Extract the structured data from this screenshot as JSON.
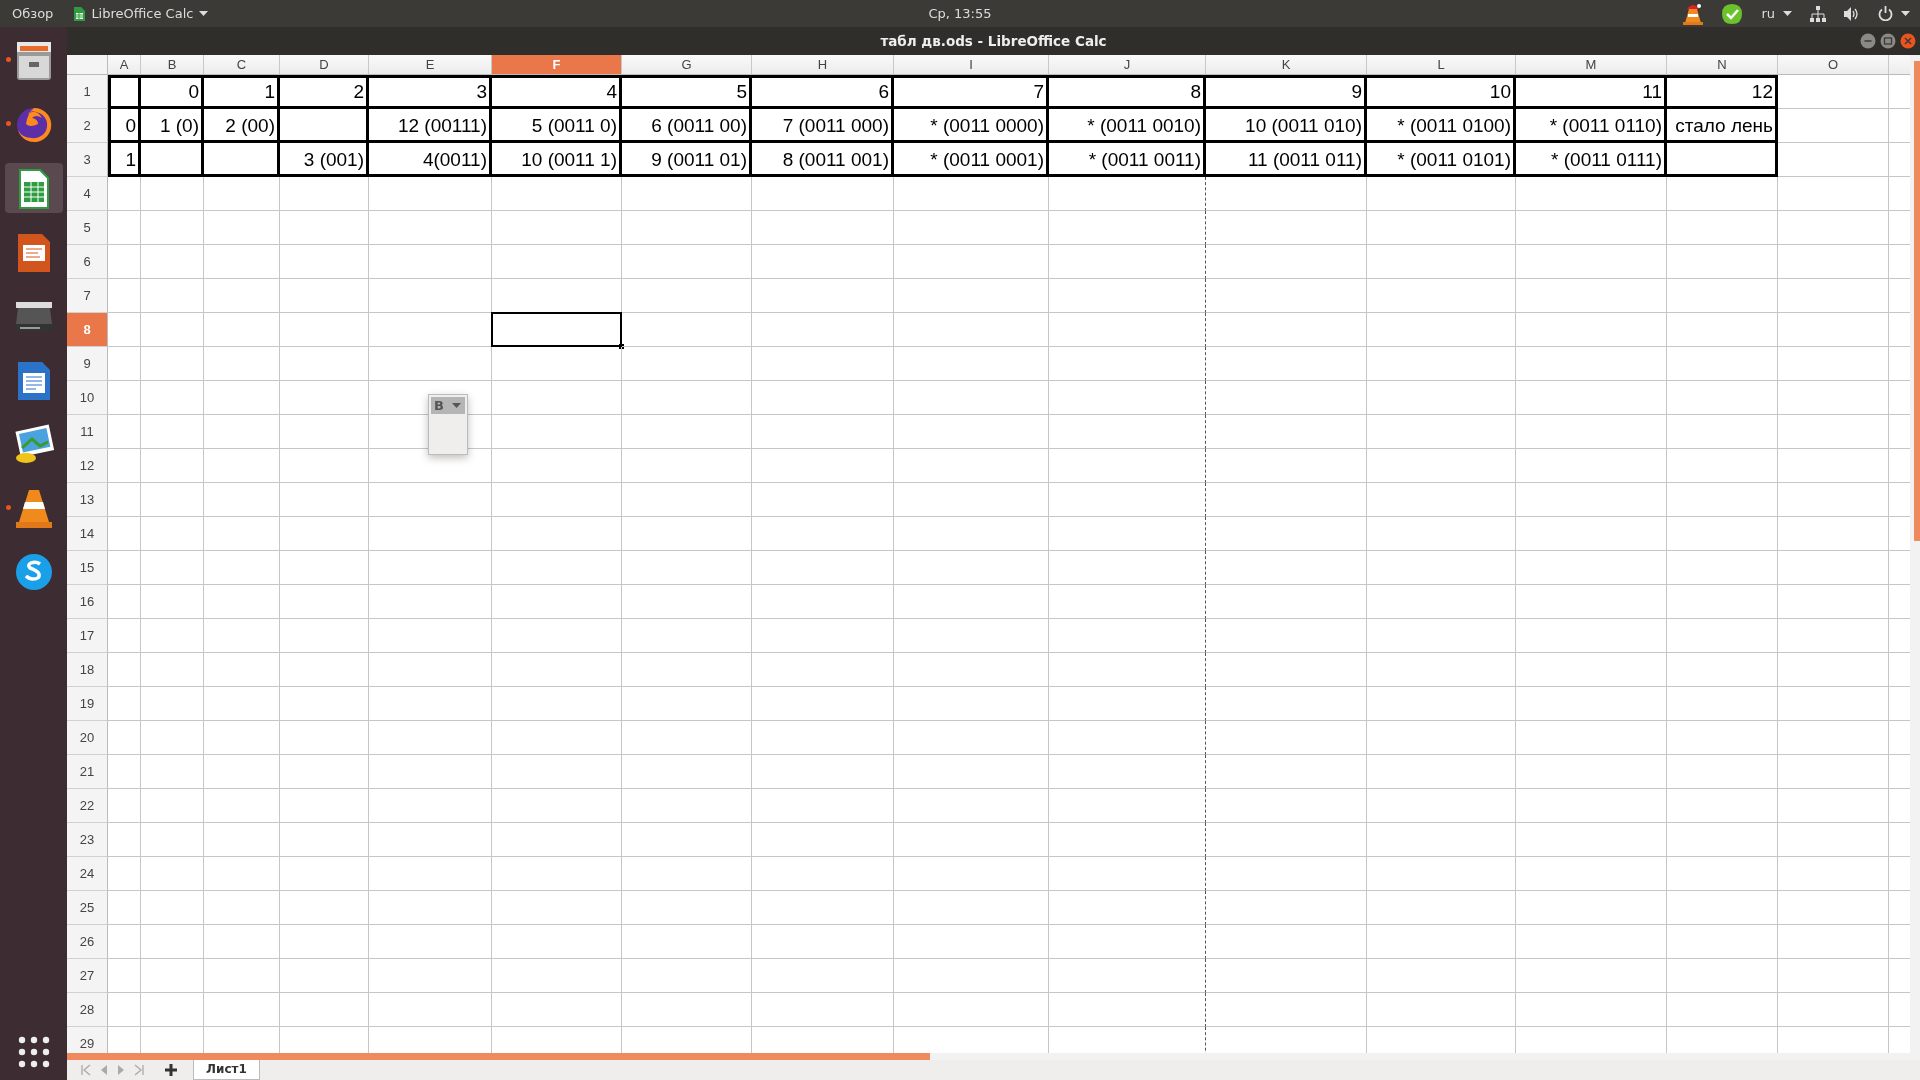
{
  "top_bar": {
    "activities": "Обзор",
    "app_menu": "LibreOffice Calc",
    "clock": "Ср, 13:55",
    "language": "ru"
  },
  "dock": {
    "items": [
      {
        "kind": "files",
        "running": true,
        "selected": false
      },
      {
        "kind": "browser",
        "running": true,
        "selected": false
      },
      {
        "kind": "spreadsheet",
        "running": false,
        "selected": true
      },
      {
        "kind": "presentation",
        "running": false,
        "selected": false
      },
      {
        "kind": "scanner",
        "running": false,
        "selected": false
      },
      {
        "kind": "document",
        "running": false,
        "selected": false
      },
      {
        "kind": "image-viewer",
        "running": false,
        "selected": false
      },
      {
        "kind": "media-player",
        "running": true,
        "selected": false
      },
      {
        "kind": "chat",
        "running": false,
        "selected": false
      }
    ]
  },
  "window": {
    "title": "табл дв.ods - LibreOffice Calc"
  },
  "columns": [
    {
      "label": "A",
      "selected": false
    },
    {
      "label": "B",
      "selected": false
    },
    {
      "label": "C",
      "selected": false
    },
    {
      "label": "D",
      "selected": false
    },
    {
      "label": "E",
      "selected": false
    },
    {
      "label": "F",
      "selected": true
    },
    {
      "label": "G",
      "selected": false
    },
    {
      "label": "H",
      "selected": false
    },
    {
      "label": "I",
      "selected": false
    },
    {
      "label": "J",
      "selected": false
    },
    {
      "label": "K",
      "selected": false
    },
    {
      "label": "L",
      "selected": false
    },
    {
      "label": "M",
      "selected": false
    },
    {
      "label": "N",
      "selected": false
    },
    {
      "label": "O",
      "selected": false
    }
  ],
  "row_headers": [
    {
      "label": "1",
      "selected": false
    },
    {
      "label": "2",
      "selected": false
    },
    {
      "label": "3",
      "selected": false
    },
    {
      "label": "4",
      "selected": false
    },
    {
      "label": "5",
      "selected": false
    },
    {
      "label": "6",
      "selected": false
    },
    {
      "label": "7",
      "selected": false
    },
    {
      "label": "8",
      "selected": true
    },
    {
      "label": "9",
      "selected": false
    },
    {
      "label": "10",
      "selected": false
    },
    {
      "label": "11",
      "selected": false
    },
    {
      "label": "12",
      "selected": false
    },
    {
      "label": "13",
      "selected": false
    },
    {
      "label": "14",
      "selected": false
    },
    {
      "label": "15",
      "selected": false
    },
    {
      "label": "16",
      "selected": false
    },
    {
      "label": "17",
      "selected": false
    },
    {
      "label": "18",
      "selected": false
    },
    {
      "label": "19",
      "selected": false
    },
    {
      "label": "20",
      "selected": false
    },
    {
      "label": "21",
      "selected": false
    },
    {
      "label": "22",
      "selected": false
    },
    {
      "label": "23",
      "selected": false
    },
    {
      "label": "24",
      "selected": false
    },
    {
      "label": "25",
      "selected": false
    },
    {
      "label": "26",
      "selected": false
    },
    {
      "label": "27",
      "selected": false
    },
    {
      "label": "28",
      "selected": false
    },
    {
      "label": "29",
      "selected": false
    }
  ],
  "data": [
    [
      {
        "kind": "blank"
      },
      {
        "kind": "filled",
        "text": "0"
      },
      {
        "kind": "filled",
        "text": "1"
      },
      {
        "kind": "filled",
        "text": "2"
      },
      {
        "kind": "filled",
        "text": "3"
      },
      {
        "kind": "filled",
        "text": "4"
      },
      {
        "kind": "filled",
        "text": "5"
      },
      {
        "kind": "filled",
        "text": "6"
      },
      {
        "kind": "filled",
        "text": "7"
      },
      {
        "kind": "filled",
        "text": "8"
      },
      {
        "kind": "filled",
        "text": "9"
      },
      {
        "kind": "filled",
        "text": "10"
      },
      {
        "kind": "filled",
        "text": "11"
      },
      {
        "kind": "filled",
        "text": "12"
      }
    ],
    [
      {
        "kind": "filled",
        "text": "0"
      },
      {
        "kind": "filled",
        "text": "1 (0)"
      },
      {
        "kind": "filled",
        "text": "2 (00)"
      },
      {
        "kind": "blank"
      },
      {
        "kind": "filled",
        "text": "12 (00111)"
      },
      {
        "kind": "filled",
        "text": "5 (0011 0)"
      },
      {
        "kind": "filled",
        "text": "6 (0011 00)"
      },
      {
        "kind": "filled",
        "text": "7 (0011 000)"
      },
      {
        "kind": "filled",
        "text": "* (0011 0000)"
      },
      {
        "kind": "filled",
        "text": "* (0011 0010)"
      },
      {
        "kind": "filled",
        "text": "10 (0011 010)"
      },
      {
        "kind": "filled",
        "text": "* (0011 0100)"
      },
      {
        "kind": "filled",
        "text": "* (0011 0110)"
      },
      {
        "kind": "filled",
        "text": "стало лень"
      }
    ],
    [
      {
        "kind": "filled",
        "text": "1"
      },
      {
        "kind": "blank"
      },
      {
        "kind": "blank"
      },
      {
        "kind": "filled",
        "text": "3 (001)"
      },
      {
        "kind": "filled",
        "text": "4(0011)"
      },
      {
        "kind": "filled",
        "text": "10 (0011 1)"
      },
      {
        "kind": "filled",
        "text": "9 (0011 01)"
      },
      {
        "kind": "filled",
        "text": "8 (0011 001)"
      },
      {
        "kind": "filled",
        "text": "* (0011 0001)"
      },
      {
        "kind": "filled",
        "text": "* (0011 0011)"
      },
      {
        "kind": "filled",
        "text": "11 (0011 011)"
      },
      {
        "kind": "filled",
        "text": "* (0011 0101)"
      },
      {
        "kind": "filled",
        "text": "* (0011 0111)"
      },
      {
        "kind": "blank"
      }
    ]
  ],
  "floating_toolbar": {
    "button": "B"
  },
  "sheet_tabs": [
    {
      "label": "Лист1",
      "selected": true
    }
  ]
}
